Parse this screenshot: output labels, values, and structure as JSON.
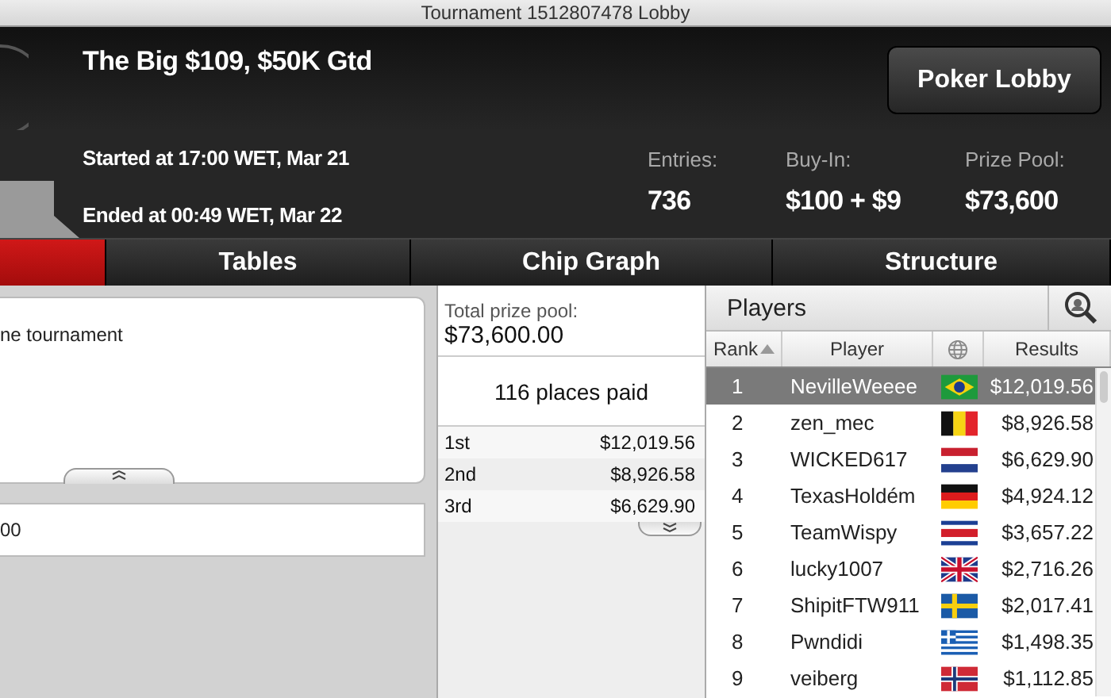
{
  "window": {
    "title": "Tournament 1512807478 Lobby"
  },
  "header": {
    "name": "The Big $109, $50K Gtd",
    "started": "Started at 17:00 WET, Mar 21",
    "ended": "Ended at 00:49 WET, Mar 22",
    "lobby_button": "Poker Lobby",
    "stats": [
      {
        "label": "Entries:",
        "value": "736"
      },
      {
        "label": "Buy-In:",
        "value": "$100 + $9"
      },
      {
        "label": "Prize Pool:",
        "value": "$73,600"
      }
    ]
  },
  "tabs": [
    {
      "selected": true
    },
    {
      "label": "Tables",
      "selected": false
    },
    {
      "label": "Chip Graph",
      "selected": false
    },
    {
      "label": "Structure",
      "selected": false
    }
  ],
  "info": {
    "text": "ne tournament",
    "field": "00"
  },
  "prizes": {
    "total_label": "Total prize pool:",
    "total": "$73,600.00",
    "places": "116 places paid",
    "rows": [
      {
        "place": "1st",
        "amount": "$12,019.56"
      },
      {
        "place": "2nd",
        "amount": "$8,926.58"
      },
      {
        "place": "3rd",
        "amount": "$6,629.90"
      }
    ]
  },
  "players": {
    "title": "Players",
    "columns": [
      "Rank",
      "Player",
      "Results"
    ],
    "rows": [
      {
        "rank": "1",
        "name": "NevilleWeeee",
        "kind": "brazil",
        "result": "$12,019.56",
        "selected": true
      },
      {
        "rank": "2",
        "name": "zen_mec",
        "kind": "belgium",
        "result": "$8,926.58",
        "selected": false
      },
      {
        "rank": "3",
        "name": "WICKED617",
        "kind": "netherlands",
        "result": "$6,629.90",
        "selected": false
      },
      {
        "rank": "4",
        "name": "TexasHoldém",
        "kind": "germany",
        "result": "$4,924.12",
        "selected": false
      },
      {
        "rank": "5",
        "name": "TeamWispy",
        "kind": "costarica",
        "result": "$3,657.22",
        "selected": false
      },
      {
        "rank": "6",
        "name": "lucky1007",
        "kind": "uk",
        "result": "$2,716.26",
        "selected": false
      },
      {
        "rank": "7",
        "name": "ShipitFTW911",
        "kind": "sweden",
        "result": "$2,017.41",
        "selected": false
      },
      {
        "rank": "8",
        "name": "Pwndidi",
        "kind": "greece",
        "result": "$1,498.35",
        "selected": false
      },
      {
        "rank": "9",
        "name": "veiberg",
        "kind": "norway",
        "result": "$1,112.85",
        "selected": false
      }
    ]
  }
}
